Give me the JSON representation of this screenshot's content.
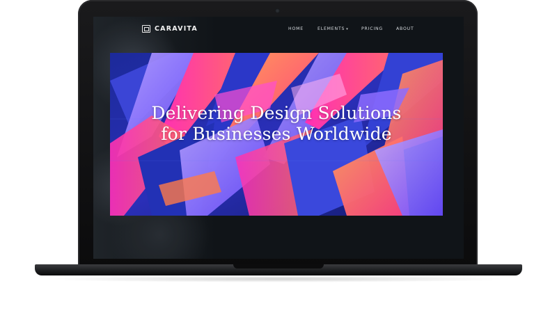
{
  "site": {
    "brand_name": "CARAVITA",
    "brand_icon": "caravita-logo-icon"
  },
  "nav": {
    "items": [
      {
        "label": "HOME"
      },
      {
        "label": "ELEMENTS",
        "has_dropdown": true
      },
      {
        "label": "PRICING"
      },
      {
        "label": "ABOUT"
      }
    ],
    "dropdown_icon": "chevron-down-icon"
  },
  "hero": {
    "title_line1": "Delivering Design Solutions",
    "title_line2": "for Businesses Worldwide"
  },
  "colors": {
    "hero_blue": "#2633c9",
    "hero_pink": "#ff2fb5",
    "hero_orange": "#ff7a4a",
    "hero_violet": "#8d6cff",
    "screen_bg": "#101418"
  }
}
